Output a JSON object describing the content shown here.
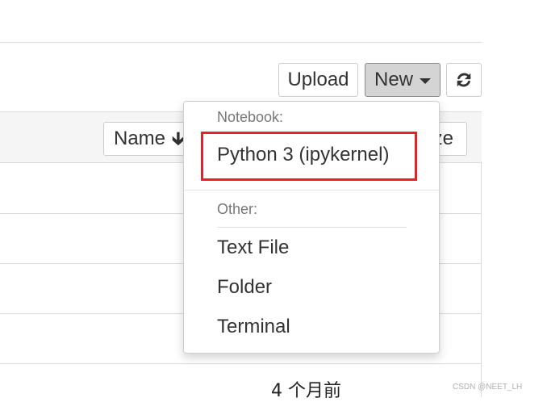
{
  "toolbar": {
    "upload_label": "Upload",
    "new_label": "New",
    "refresh_icon": "refresh-icon"
  },
  "list_header": {
    "name_label": "Name",
    "name_sort_icon": "arrow-down-icon",
    "size_label_visible_fragment": "ze"
  },
  "file_list": {
    "last_modified": "4 个月前"
  },
  "new_menu": {
    "notebook_header": "Notebook:",
    "notebook_items": [
      "Python 3 (ipykernel)"
    ],
    "other_header": "Other:",
    "other_items": [
      "Text File",
      "Folder",
      "Terminal"
    ]
  },
  "annotation": {
    "highlight_color": "#e8202a"
  },
  "watermark": "CSDN @NEET_LH"
}
